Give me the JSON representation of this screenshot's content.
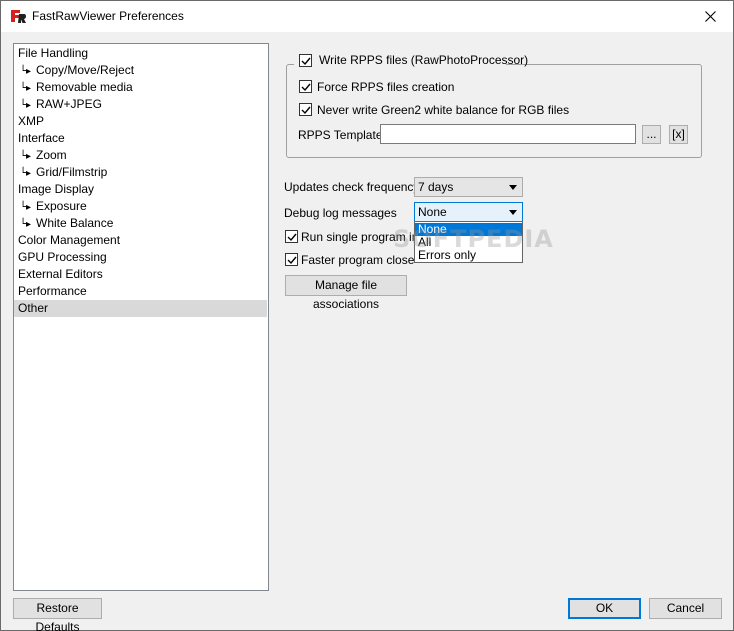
{
  "window": {
    "title": "FastRawViewer Preferences"
  },
  "sidebar": {
    "items": [
      {
        "label": "File Handling",
        "level": 0
      },
      {
        "label": "Copy/Move/Reject",
        "level": 1
      },
      {
        "label": "Removable media",
        "level": 1
      },
      {
        "label": "RAW+JPEG",
        "level": 1
      },
      {
        "label": "XMP",
        "level": 0
      },
      {
        "label": "Interface",
        "level": 0
      },
      {
        "label": "Zoom",
        "level": 1
      },
      {
        "label": "Grid/Filmstrip",
        "level": 1
      },
      {
        "label": "Image Display",
        "level": 0
      },
      {
        "label": "Exposure",
        "level": 1
      },
      {
        "label": "White Balance",
        "level": 1
      },
      {
        "label": "Color Management",
        "level": 0
      },
      {
        "label": "GPU Processing",
        "level": 0
      },
      {
        "label": "External Editors",
        "level": 0
      },
      {
        "label": "Performance",
        "level": 0
      },
      {
        "label": "Other",
        "level": 0,
        "selected": true
      }
    ],
    "sub_marker": "└▸"
  },
  "rpps": {
    "write_label": "Write RPPS files (RawPhotoProcessor)",
    "write_checked": true,
    "force_label": "Force RPPS files creation",
    "force_checked": true,
    "never_green2_label": "Never write Green2 white balance for RGB files",
    "never_green2_checked": true,
    "template_label": "RPPS Template:",
    "template_value": "",
    "browse_label": "...",
    "clear_label": "[x]"
  },
  "updates": {
    "label": "Updates check frequency",
    "value": "7 days"
  },
  "debug": {
    "label": "Debug log messages",
    "value": "None",
    "options": [
      "None",
      "All",
      "Errors only"
    ],
    "highlighted_index": 0
  },
  "run_single": {
    "label": "Run single program inst",
    "checked": true
  },
  "faster_close": {
    "label": "Faster program close",
    "checked": true
  },
  "manage_assoc_label": "Manage file associations",
  "watermark": "SOFTPEDIA",
  "footer": {
    "restore_label": "Restore Defaults",
    "ok_label": "OK",
    "cancel_label": "Cancel"
  },
  "colors": {
    "accent": "#0078d7",
    "selection": "#d9d9d9"
  }
}
